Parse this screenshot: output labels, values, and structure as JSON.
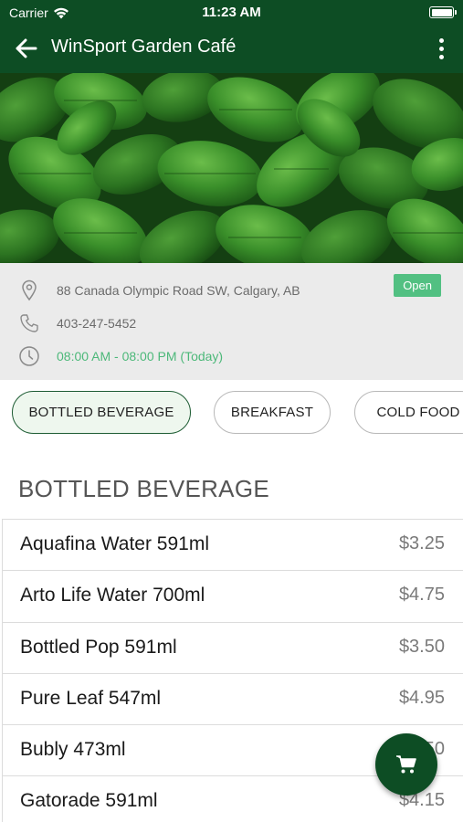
{
  "status_bar": {
    "carrier": "Carrier",
    "time": "11:23 AM"
  },
  "header": {
    "title": "WinSport Garden Café"
  },
  "info": {
    "address": "88 Canada Olympic Road SW, Calgary, AB",
    "phone": "403-247-5452",
    "hours": "08:00 AM - 08:00 PM (Today)",
    "open_badge": "Open"
  },
  "categories": [
    {
      "label": "BOTTLED BEVERAGE",
      "active": true
    },
    {
      "label": "BREAKFAST",
      "active": false
    },
    {
      "label": "COLD FOOD",
      "active": false
    }
  ],
  "section": {
    "title": "BOTTLED BEVERAGE"
  },
  "menu_items": [
    {
      "name": "Aquafina Water 591ml",
      "price": "$3.25"
    },
    {
      "name": "Arto Life Water 700ml",
      "price": "$4.75"
    },
    {
      "name": "Bottled Pop 591ml",
      "price": "$3.50"
    },
    {
      "name": "Pure Leaf 547ml",
      "price": "$4.95"
    },
    {
      "name": "Bubly 473ml",
      "price": "$3.50"
    },
    {
      "name": "Gatorade 591ml",
      "price": "$4.15"
    }
  ],
  "colors": {
    "header_bg": "#0d4d24",
    "open_badge": "#52c082",
    "hours_text": "#4cb879"
  },
  "icons": {
    "back": "arrow-left-icon",
    "more": "more-vertical-icon",
    "location": "location-pin-icon",
    "phone": "phone-icon",
    "clock": "clock-icon",
    "cart": "shopping-cart-icon",
    "wifi": "wifi-icon"
  }
}
